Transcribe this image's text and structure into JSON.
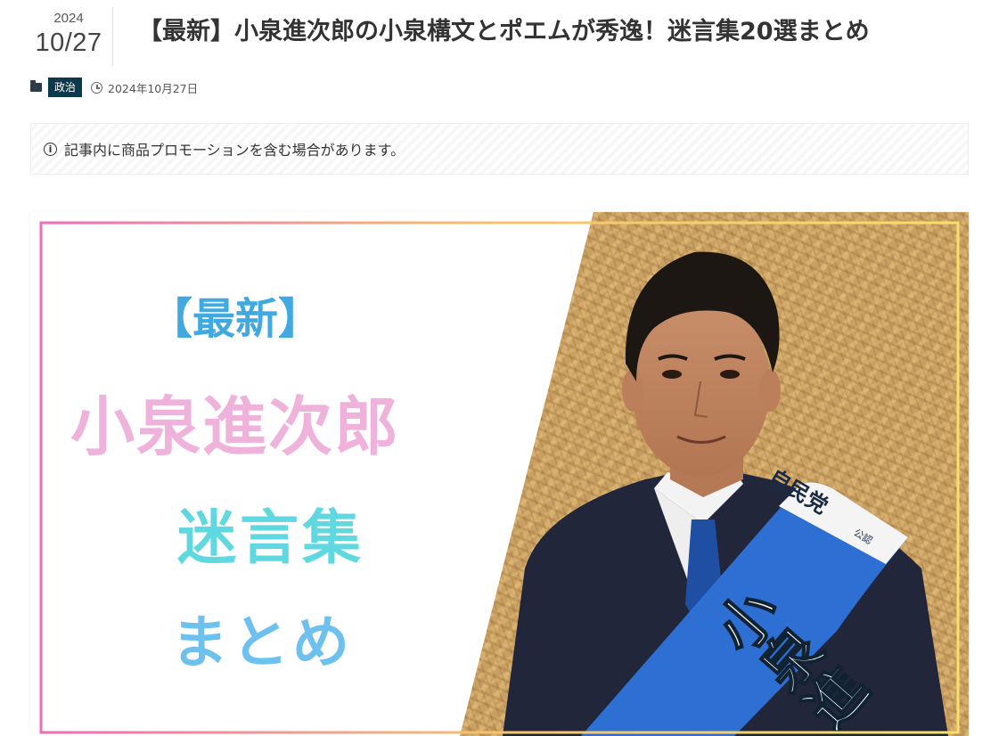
{
  "header": {
    "year": "2024",
    "month_day": "10/27",
    "title": "【最新】小泉進次郎の小泉構文とポエムが秀逸！迷言集20選まとめ"
  },
  "meta": {
    "category_icon": "folder-icon",
    "category": "政治",
    "date_icon": "clock-icon",
    "date": "2024年10月27日"
  },
  "notice": {
    "icon": "info-icon",
    "text": "記事内に商品プロモーションを含む場合があります。"
  },
  "hero": {
    "line1": "【最新】",
    "line2": "小泉進次郎",
    "line3": "迷言集",
    "line4": "まとめ",
    "sash_party": "自民党",
    "sash_tag": "公認",
    "sash_name": "小泉進",
    "colors": {
      "line1": "#3fa9e0",
      "line2": "#eeb2db",
      "line3": "#5fd8e0",
      "line4": "#6ec1ee",
      "sash": "#2d6fd3",
      "board": "#c9a064"
    }
  }
}
